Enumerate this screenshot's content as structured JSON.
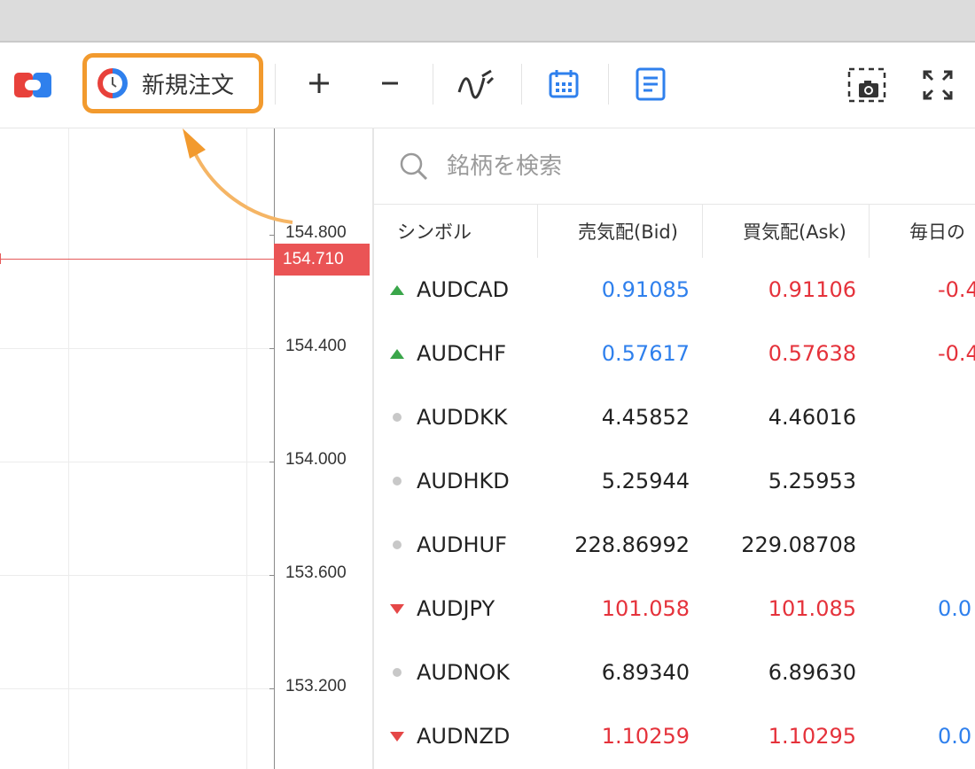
{
  "toolbar": {
    "new_order_label": "新規注文"
  },
  "chart": {
    "price_levels": [
      "154.800",
      "154.400",
      "154.000",
      "153.600",
      "153.200"
    ],
    "current_price": "154.710",
    "current_price_color": "#ea5455"
  },
  "watchlist": {
    "search_placeholder": "銘柄を検索",
    "headers": {
      "symbol": "シンボル",
      "bid": "売気配(Bid)",
      "ask": "買気配(Ask)",
      "daily": "毎日の"
    },
    "rows": [
      {
        "symbol": "AUDCAD",
        "direction": "up",
        "bid": "0.91085",
        "ask": "0.91106",
        "bid_color": "blue",
        "ask_color": "red",
        "change": "-0.4",
        "change_color": "red"
      },
      {
        "symbol": "AUDCHF",
        "direction": "up",
        "bid": "0.57617",
        "ask": "0.57638",
        "bid_color": "blue",
        "ask_color": "red",
        "change": "-0.4",
        "change_color": "red"
      },
      {
        "symbol": "AUDDKK",
        "direction": "neutral",
        "bid": "4.45852",
        "ask": "4.46016",
        "bid_color": "dark",
        "ask_color": "dark",
        "change": "",
        "change_color": "dark"
      },
      {
        "symbol": "AUDHKD",
        "direction": "neutral",
        "bid": "5.25944",
        "ask": "5.25953",
        "bid_color": "dark",
        "ask_color": "dark",
        "change": "",
        "change_color": "dark"
      },
      {
        "symbol": "AUDHUF",
        "direction": "neutral",
        "bid": "228.86992",
        "ask": "229.08708",
        "bid_color": "dark",
        "ask_color": "dark",
        "change": "",
        "change_color": "dark"
      },
      {
        "symbol": "AUDJPY",
        "direction": "down",
        "bid": "101.058",
        "ask": "101.085",
        "bid_color": "red",
        "ask_color": "red",
        "change": "0.0",
        "change_color": "blue"
      },
      {
        "symbol": "AUDNOK",
        "direction": "neutral",
        "bid": "6.89340",
        "ask": "6.89630",
        "bid_color": "dark",
        "ask_color": "dark",
        "change": "",
        "change_color": "dark"
      },
      {
        "symbol": "AUDNZD",
        "direction": "down",
        "bid": "1.10259",
        "ask": "1.10295",
        "bid_color": "red",
        "ask_color": "red",
        "change": "0.0",
        "change_color": "blue"
      }
    ]
  },
  "colors": {
    "highlight_orange": "#f29a2e",
    "accent_blue": "#2f80ed",
    "up_green": "#3aa64a",
    "down_red": "#e54747"
  }
}
